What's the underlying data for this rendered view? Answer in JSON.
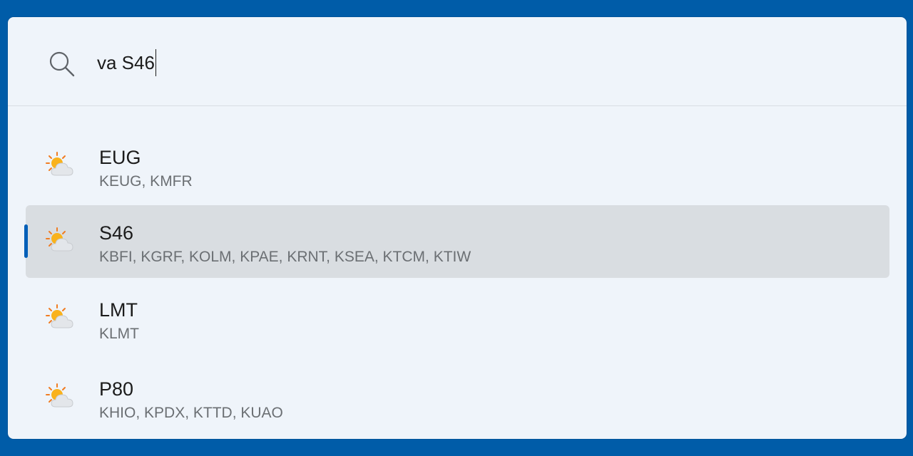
{
  "search": {
    "query": "va S46",
    "icon": "search-icon"
  },
  "results": [
    {
      "title": "EUG",
      "subtitle": "KEUG, KMFR",
      "icon": "partly-cloudy-icon",
      "selected": false
    },
    {
      "title": "S46",
      "subtitle": "KBFI, KGRF, KOLM, KPAE, KRNT, KSEA, KTCM, KTIW",
      "icon": "partly-cloudy-icon",
      "selected": true
    },
    {
      "title": "LMT",
      "subtitle": "KLMT",
      "icon": "partly-cloudy-icon",
      "selected": false
    },
    {
      "title": "P80",
      "subtitle": "KHIO, KPDX, KTTD, KUAO",
      "icon": "partly-cloudy-icon",
      "selected": false
    }
  ],
  "colors": {
    "background": "#005ca8",
    "panel": "#eff4fa",
    "selected_row": "#d9dde1",
    "accent": "#005fb8"
  }
}
